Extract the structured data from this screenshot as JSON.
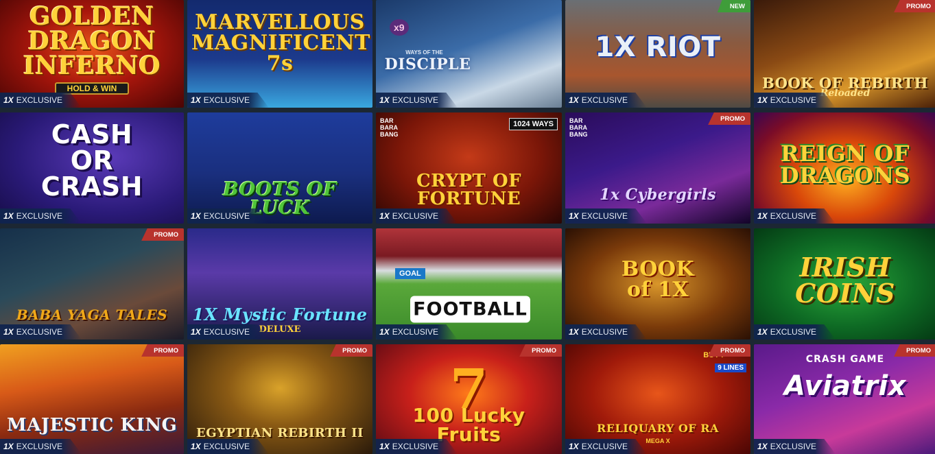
{
  "exclusive_label": "EXCLUSIVE",
  "exclusive_prefix": "1X",
  "tiles": [
    {
      "title": "GOLDEN DRAGON INFERNO",
      "sub": "HOLD & WIN",
      "badge": ""
    },
    {
      "title": "MARVELLOUS MAGNIFICENT 7s",
      "sub": "",
      "badge": ""
    },
    {
      "title": "DISCIPLE",
      "sub": "WAYS OF THE",
      "badge": "",
      "corner": "x9"
    },
    {
      "title": "1X RIOT",
      "sub": "",
      "badge": "NEW"
    },
    {
      "title": "BOOK OF REBIRTH",
      "sub": "Reloaded",
      "badge": "PROMO"
    },
    {
      "title": "CASH OR CRASH",
      "sub": "",
      "badge": ""
    },
    {
      "title": "BOOTS OF LUCK",
      "sub": "",
      "badge": ""
    },
    {
      "title": "CRYPT OF FORTUNE",
      "sub": "1024 WAYS",
      "badge": "",
      "corner": "BAR BARA BANG"
    },
    {
      "title": "1x Cybergirls",
      "sub": "",
      "badge": "PROMO",
      "corner": "BAR BARA BANG"
    },
    {
      "title": "REIGN OF DRAGONS",
      "sub": "",
      "badge": ""
    },
    {
      "title": "BABA YAGA TALES",
      "sub": "",
      "badge": "PROMO"
    },
    {
      "title": "1X Mystic Fortune",
      "sub": "DELUXE",
      "badge": ""
    },
    {
      "title": "FOOTBALL",
      "sub": "GOAL",
      "badge": ""
    },
    {
      "title": "BOOK of 1X",
      "sub": "",
      "badge": ""
    },
    {
      "title": "IRISH COINS",
      "sub": "",
      "badge": ""
    },
    {
      "title": "MAJESTIC KING",
      "sub": "",
      "badge": "PROMO"
    },
    {
      "title": "EGYPTIAN REBIRTH II",
      "sub": "",
      "badge": "PROMO"
    },
    {
      "title": "100 Lucky Fruits",
      "sub": "",
      "badge": "PROMO"
    },
    {
      "title": "RELIQUARY OF RA",
      "sub": "MEGA X",
      "badge": "PROMO",
      "corner": "BUY F",
      "corner2": "9 LINES"
    },
    {
      "title": "Aviatrix",
      "sub": "CRASH GAME",
      "badge": "PROMO"
    }
  ]
}
